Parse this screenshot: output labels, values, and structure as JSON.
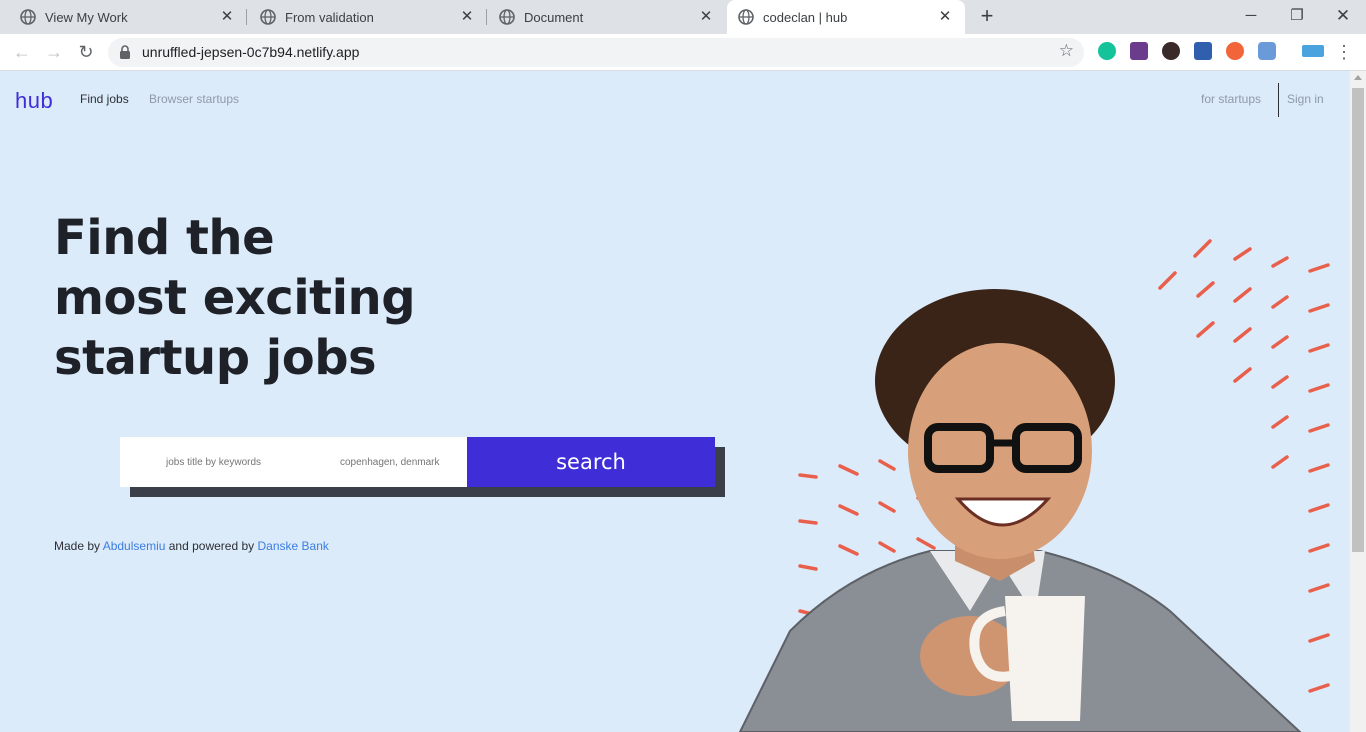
{
  "browser": {
    "tabs": [
      {
        "title": "View My Work",
        "active": false
      },
      {
        "title": "From validation",
        "active": false
      },
      {
        "title": "Document",
        "active": false
      },
      {
        "title": "codeclan | hub",
        "active": true
      }
    ],
    "url": "unruffled-jepsen-0c7b94.netlify.app",
    "extensions": [
      "grammarly-icon",
      "eyedropper-icon",
      "k-extension-icon",
      "download-icon",
      "fox-icon",
      "cloud-icon",
      "window-icon"
    ]
  },
  "header": {
    "logo": "hub",
    "nav": {
      "find_jobs": "Find jobs",
      "browse": "Browser startups",
      "for_startups": "for startups",
      "sign_in": "Sign in"
    }
  },
  "hero": {
    "title_lines": [
      "Find the",
      "most exciting",
      "startup jobs"
    ]
  },
  "search": {
    "keywords_placeholder": "jobs title by keywords",
    "location_placeholder": "copenhagen, denmark",
    "button_label": "search"
  },
  "footer": {
    "made_by": "Made by",
    "author": "Abdulsemiu",
    "powered": "and powered by",
    "sponsor": "Danske Bank"
  },
  "colors": {
    "page_bg": "#dcebf9",
    "brand": "#3f2ed8",
    "accent_stripes": "#e8604c",
    "heading": "#1f2128",
    "link": "#3b7ee0"
  }
}
